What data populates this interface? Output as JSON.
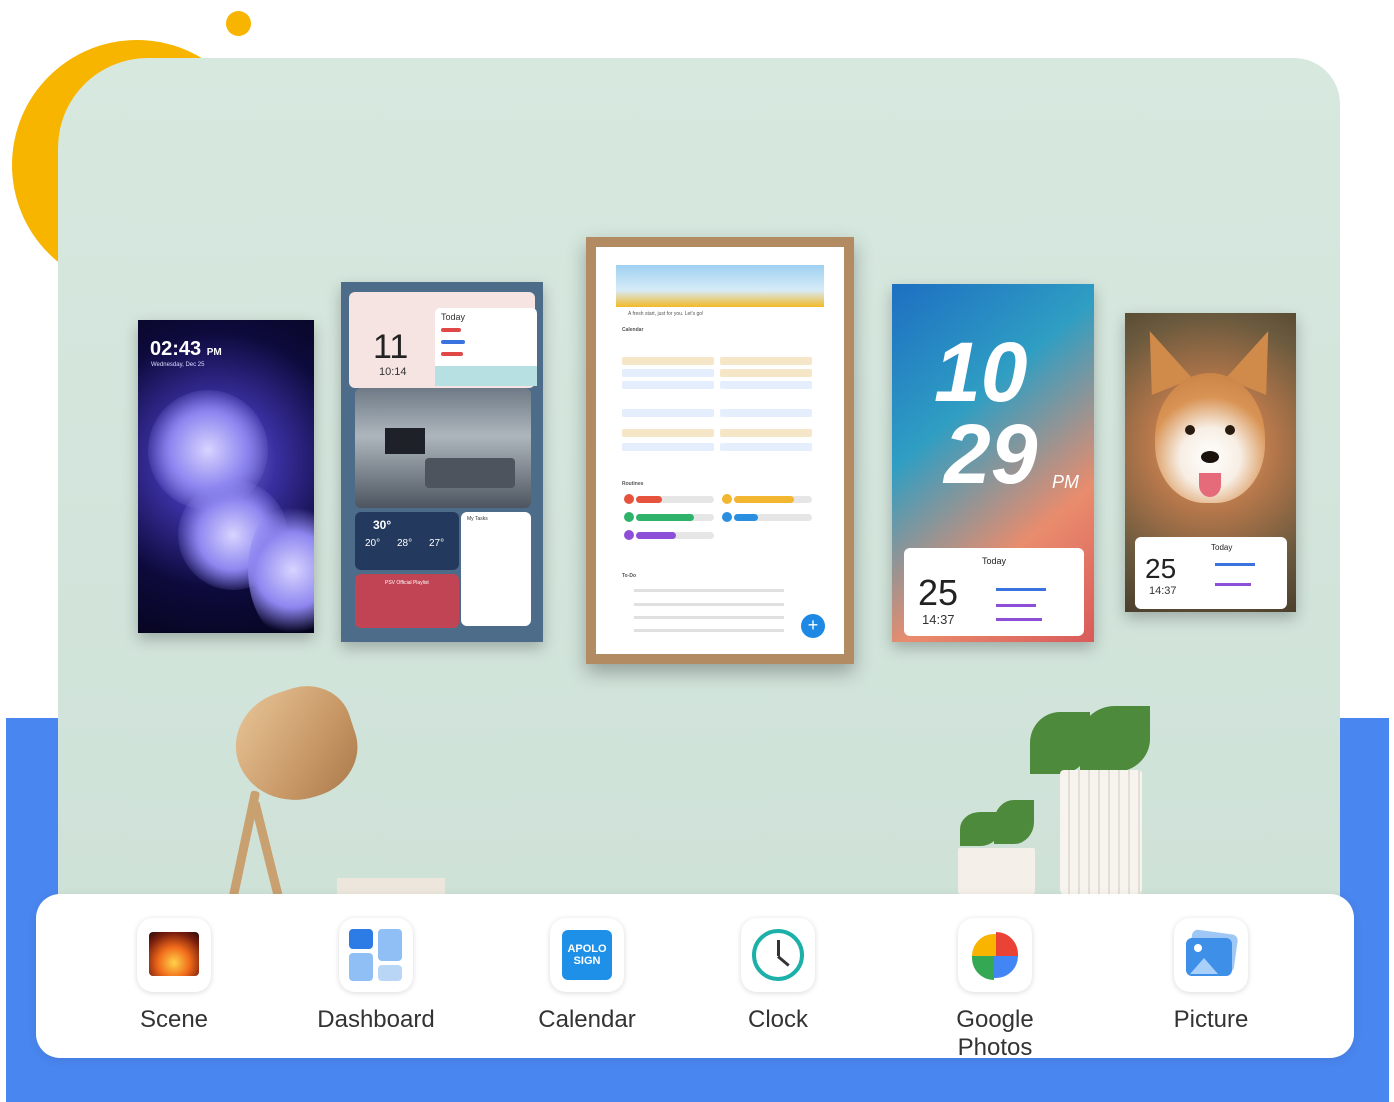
{
  "devices": {
    "lock_screen": {
      "time": "02:43",
      "ampm": "PM",
      "date": "Wednesday, Dec 25"
    },
    "dashboard": {
      "day": "11",
      "time": "10:14",
      "today_label": "Today",
      "temp_main": "30°",
      "temp_a": "20°",
      "temp_b": "28°",
      "temp_c": "27°",
      "tasks_title": "My Tasks",
      "music_title": "PSV Official Playlist"
    },
    "calendar_frame": {
      "greeting": "A fresh start, just for you. Let's go!",
      "calendar_label": "Calendar",
      "routines_label": "Routines",
      "todo_label": "To-Do",
      "fab": "+"
    },
    "clock_screen": {
      "hour": "10",
      "minute": "29",
      "ampm": "PM",
      "day": "25",
      "time": "14:37",
      "today_label": "Today"
    },
    "photo_screen": {
      "day": "25",
      "time": "14:37",
      "today_label": "Today"
    }
  },
  "dock": {
    "apps": [
      {
        "label": "Scene",
        "icon": "fireplace-icon"
      },
      {
        "label": "Dashboard",
        "icon": "dashboard-grid-icon"
      },
      {
        "label": "Calendar",
        "icon": "apolosign-calendar-icon",
        "icon_text": "APOLO SIGN"
      },
      {
        "label": "Clock",
        "icon": "clock-icon"
      },
      {
        "label": "Google Photos",
        "icon": "google-photos-pinwheel-icon"
      },
      {
        "label": "Picture",
        "icon": "picture-icon"
      }
    ]
  },
  "colors": {
    "floor": "#4a86ef",
    "sun": "#f7b500",
    "wall": "#d7e8df",
    "accent": "#1e88e5"
  }
}
